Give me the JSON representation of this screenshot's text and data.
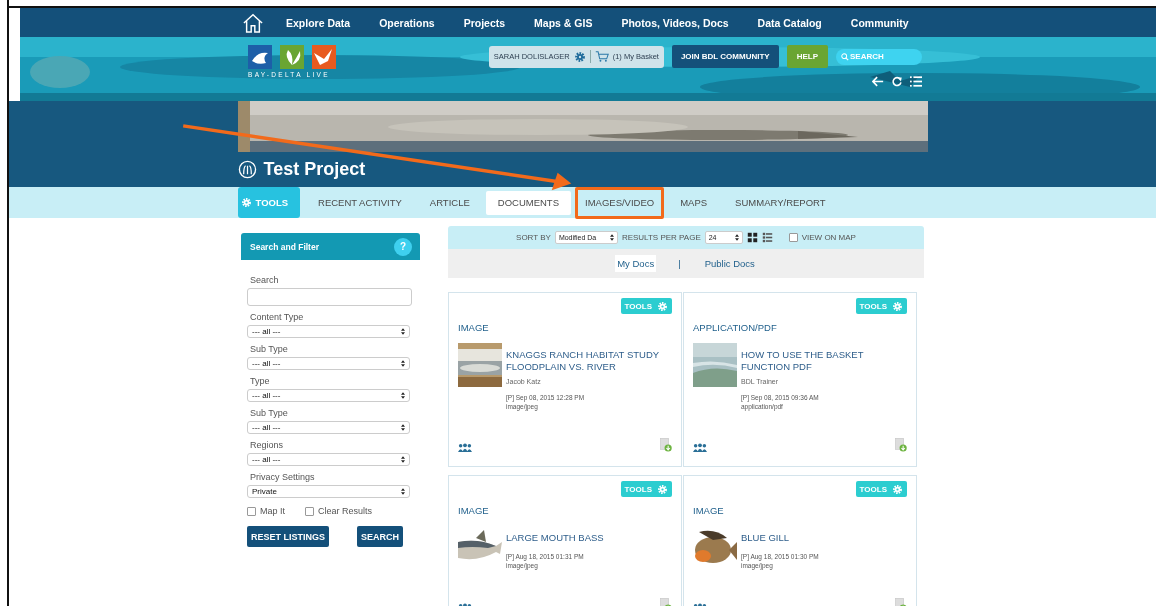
{
  "nav": {
    "items": [
      "Explore Data",
      "Operations",
      "Projects",
      "Maps & GIS",
      "Photos, Videos, Docs",
      "Data Catalog",
      "Community"
    ]
  },
  "header": {
    "logo_text": "BAY-DELTA LIVE",
    "user": "SARAH DOLISLAGER",
    "basket": "(1) My Basket",
    "join": "JOIN BDL COMMUNITY",
    "help": "HELP",
    "search": {
      "placeholder": "SEARCH"
    }
  },
  "project": {
    "title": "Test Project"
  },
  "tabs": [
    {
      "label": "TOOLS",
      "kind": "tools",
      "selected": false,
      "highlighted": false
    },
    {
      "label": "RECENT ACTIVITY",
      "kind": "tab",
      "selected": false,
      "highlighted": false
    },
    {
      "label": "ARTICLE",
      "kind": "tab",
      "selected": false,
      "highlighted": false
    },
    {
      "label": "DOCUMENTS",
      "kind": "tab",
      "selected": true,
      "highlighted": false
    },
    {
      "label": "IMAGES/VIDEO",
      "kind": "tab",
      "selected": false,
      "highlighted": true
    },
    {
      "label": "MAPS",
      "kind": "tab",
      "selected": false,
      "highlighted": false
    },
    {
      "label": "SUMMARY/REPORT",
      "kind": "tab",
      "selected": false,
      "highlighted": false
    }
  ],
  "filter": {
    "title": "Search and Filter",
    "help": "?",
    "fields": [
      {
        "label": "Search",
        "kind": "text"
      },
      {
        "label": "Content Type",
        "kind": "select",
        "value": "--- all ---"
      },
      {
        "label": "Sub Type",
        "kind": "select",
        "value": "--- all ---"
      },
      {
        "label": "Type",
        "kind": "select",
        "value": "--- all ---"
      },
      {
        "label": "Sub Type",
        "kind": "select",
        "value": "--- all ---"
      },
      {
        "label": "Regions",
        "kind": "select",
        "value": "--- all ---"
      },
      {
        "label": "Privacy Settings",
        "kind": "select",
        "value": "Private"
      }
    ],
    "checkboxes": [
      {
        "label": "Map It",
        "checked": false
      },
      {
        "label": "Clear Results",
        "checked": false
      }
    ],
    "buttons": [
      "RESET LISTINGS",
      "SEARCH"
    ]
  },
  "listing": {
    "sort_label": "SORT BY",
    "sort_value": "Modified Da",
    "per_page_label": "RESULTS PER PAGE",
    "per_page_value": "24",
    "views": [
      {
        "kind": "grid",
        "selected": true
      },
      {
        "kind": "list",
        "selected": false
      }
    ],
    "view_on_map": {
      "label": "VIEW ON MAP",
      "checked": false
    },
    "doc_tabs": [
      {
        "label": "My Docs",
        "selected": true
      },
      {
        "label": "Public Docs",
        "selected": false
      }
    ],
    "separator": "|",
    "cards": [
      {
        "tools": "TOOLS",
        "type": "IMAGE",
        "title": "KNAGGS RANCH HABITAT STUDY FLOODPLAIN VS. RIVER",
        "author": "Jacob Katz",
        "date": "[P] Sep 08, 2015 12:28 PM",
        "mime": "image/jpeg"
      },
      {
        "tools": "TOOLS",
        "type": "APPLICATION/PDF",
        "title": "HOW TO USE THE BASKET FUNCTION PDF",
        "author": "BDL Trainer",
        "date": "[P] Sep 08, 2015 09:36 AM",
        "mime": "application/pdf"
      },
      {
        "tools": "TOOLS",
        "type": "IMAGE",
        "title": "LARGE MOUTH BASS",
        "date": "[P] Aug 18, 2015 01:31 PM",
        "mime": "image/jpeg"
      },
      {
        "tools": "TOOLS",
        "type": "IMAGE",
        "title": "BLUE GILL",
        "date": "[P] Aug 18, 2015 01:30 PM",
        "mime": "image/jpeg"
      }
    ]
  }
}
